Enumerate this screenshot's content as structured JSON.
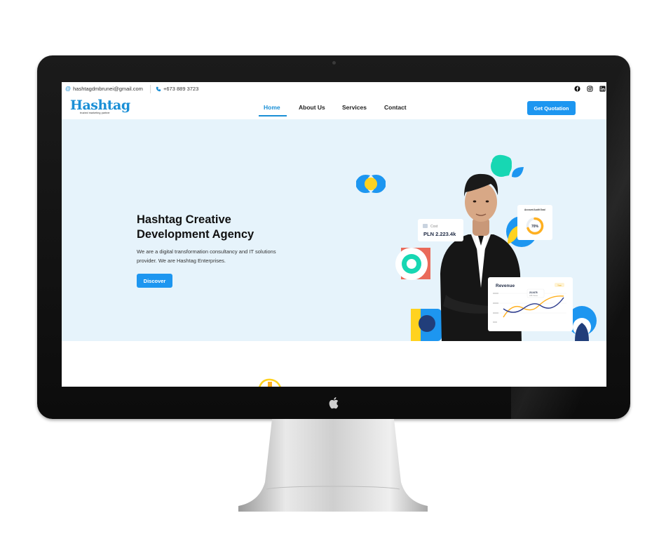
{
  "contact": {
    "email": "hashtagdmbrunei@gmail.com",
    "phone": "+673 889 3723",
    "socials": [
      "facebook-icon",
      "instagram-icon",
      "linkedin-icon"
    ]
  },
  "brand": {
    "logo_text": "Hashtag",
    "tagline": "trusted marketing partner"
  },
  "nav": {
    "items": [
      {
        "label": "Home",
        "active": true
      },
      {
        "label": "About Us",
        "active": false
      },
      {
        "label": "Services",
        "active": false
      },
      {
        "label": "Contact",
        "active": false
      }
    ],
    "cta_label": "Get Quotation"
  },
  "hero": {
    "title": "Hashtag Creative Development Agency",
    "description": "We are a digital transformation consultancy and IT solutions provider. We are Hashtag Enterprises.",
    "button_label": "Discover",
    "cards": {
      "cost_label": "Cost",
      "cost_value": "PLN 2.223.4k",
      "gauge_title": "Account Audit Goal",
      "gauge_value": "70%",
      "gauge_progress": 0.7,
      "revenue_title": "Revenue",
      "revenue_badge": "Year",
      "revenue_point_value": "23.3478",
      "revenue_point_note": "345 Views"
    }
  },
  "colors": {
    "accent": "#1d96f0",
    "hero_bg": "#e6f3fb",
    "shape_teal": "#17d7b3",
    "shape_blue": "#1d96f0",
    "shape_yellow": "#ffd21f",
    "shape_navy": "#213e7a",
    "shape_coral": "#ea6a5a"
  }
}
